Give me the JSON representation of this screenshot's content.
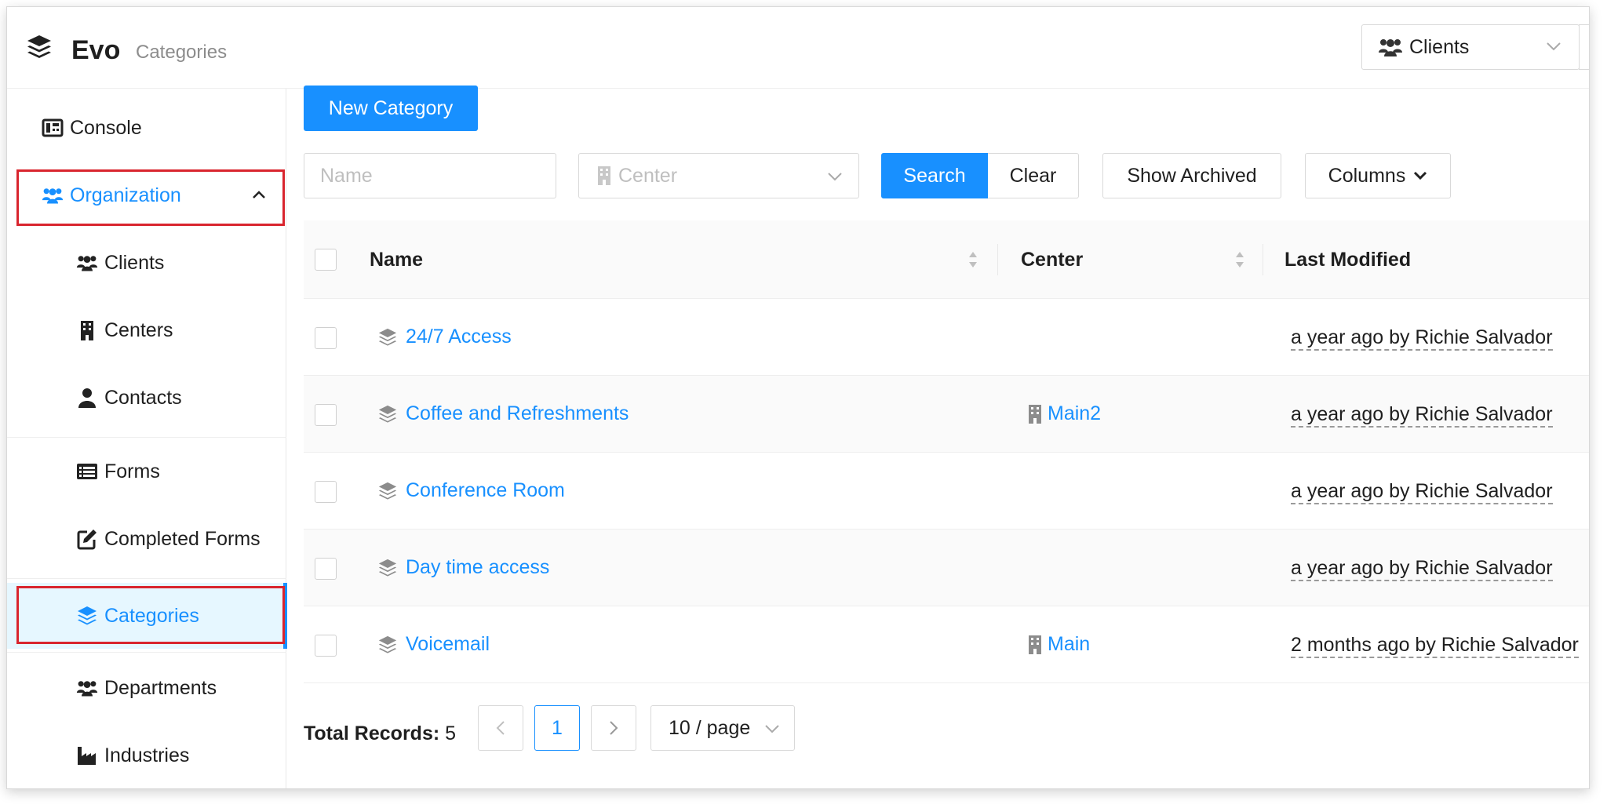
{
  "app": {
    "name": "Evo",
    "page": "Categories"
  },
  "header": {
    "client_select": "Clients"
  },
  "sidebar": {
    "items": [
      {
        "label": "Console",
        "icon": "console-icon"
      },
      {
        "label": "Organization",
        "icon": "users-icon",
        "expanded": true,
        "highlighted": true
      },
      {
        "label": "Clients",
        "icon": "users-icon"
      },
      {
        "label": "Centers",
        "icon": "building-icon"
      },
      {
        "label": "Contacts",
        "icon": "user-icon"
      },
      {
        "label": "Forms",
        "icon": "list-icon"
      },
      {
        "label": "Completed Forms",
        "icon": "edit-icon"
      },
      {
        "label": "Categories",
        "icon": "layers-icon",
        "active": true,
        "highlighted": true
      },
      {
        "label": "Departments",
        "icon": "users-icon"
      },
      {
        "label": "Industries",
        "icon": "industry-icon"
      }
    ]
  },
  "toolbar": {
    "new_label": "New Category",
    "name_placeholder": "Name",
    "center_placeholder": "Center",
    "search_label": "Search",
    "clear_label": "Clear",
    "archived_label": "Show Archived",
    "columns_label": "Columns"
  },
  "table": {
    "columns": [
      "Name",
      "Center",
      "Last Modified"
    ],
    "rows": [
      {
        "name": "24/7 Access",
        "center": "",
        "modified": "a year ago by Richie Salvador"
      },
      {
        "name": "Coffee and Refreshments",
        "center": "Main2",
        "modified": "a year ago by Richie Salvador"
      },
      {
        "name": "Conference Room",
        "center": "",
        "modified": "a year ago by Richie Salvador"
      },
      {
        "name": "Day time access",
        "center": "",
        "modified": "a year ago by Richie Salvador"
      },
      {
        "name": "Voicemail",
        "center": "Main",
        "modified": "2 months ago by Richie Salvador"
      }
    ]
  },
  "pagination": {
    "total_label": "Total Records:",
    "total": "5",
    "current_page": "1",
    "page_size": "10 / page"
  },
  "colors": {
    "accent": "#1890ff",
    "highlight_box": "#d9252e",
    "active_bg": "#e6f7ff"
  }
}
